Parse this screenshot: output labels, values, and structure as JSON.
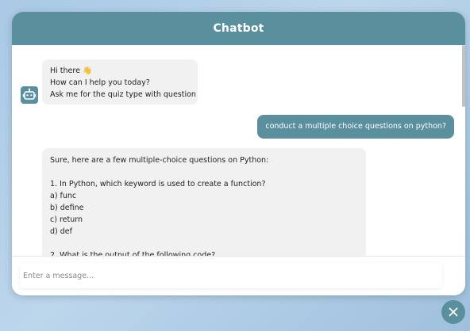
{
  "colors": {
    "accent": "#5a8f9e",
    "bot_bubble": "#f1f1f1",
    "background": "#a9c9e6"
  },
  "header": {
    "title": "Chatbot"
  },
  "messages": [
    {
      "sender": "bot",
      "avatar_icon": "robot-icon",
      "lines": [
        "Hi there 👋",
        "How can I help you today?",
        "Ask me for the quiz type with question"
      ]
    },
    {
      "sender": "user",
      "text": "conduct a multiple choice questions on python?"
    },
    {
      "sender": "bot",
      "lines": [
        "Sure, here are a few multiple-choice questions on Python:",
        "",
        "1. In Python, which keyword is used to create a function?",
        "a) func",
        "b) define",
        "c) return",
        "d) def",
        "",
        "2. What is the output of the following code?"
      ]
    }
  ],
  "input": {
    "placeholder": "Enter a message..."
  },
  "close_button": {
    "icon": "close-icon"
  }
}
